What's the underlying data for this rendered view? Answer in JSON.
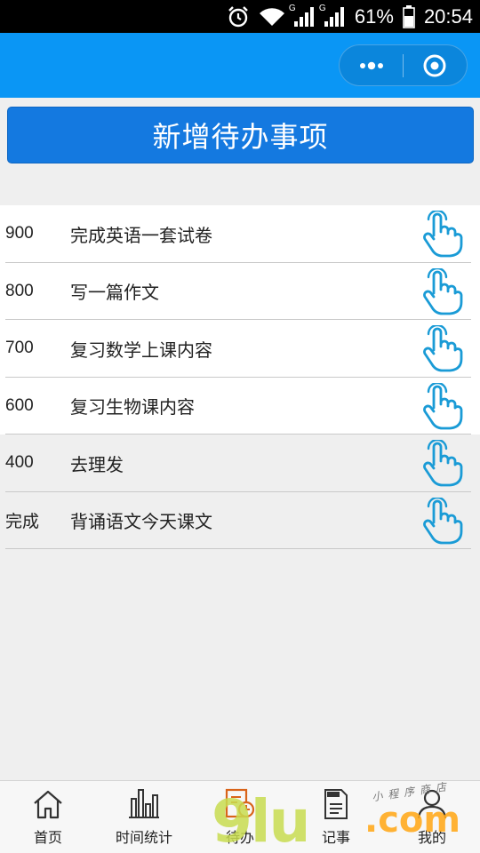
{
  "status_bar": {
    "battery": "61%",
    "time": "20:54",
    "network_label": "G",
    "icons": [
      "alarm-icon",
      "wifi-icon",
      "signal-icon",
      "signal-icon",
      "battery-icon"
    ]
  },
  "header": {
    "capsule": {
      "more_icon": "more-dots-icon",
      "close_icon": "target-circle-icon"
    }
  },
  "add_button": {
    "label": "新增待办事项"
  },
  "todos": [
    {
      "value": "900",
      "text": "完成英语一套试卷"
    },
    {
      "value": "800",
      "text": "写一篇作文"
    },
    {
      "value": "700",
      "text": "复习数学上课内容"
    },
    {
      "value": "600",
      "text": "复习生物课内容"
    },
    {
      "value": "400",
      "text": "去理发"
    },
    {
      "value": "完成",
      "text": "背诵语文今天课文"
    }
  ],
  "tabs": [
    {
      "label": "首页",
      "icon": "home-icon"
    },
    {
      "label": "时间统计",
      "icon": "bar-chart-icon"
    },
    {
      "label": "待办",
      "icon": "todo-clock-icon"
    },
    {
      "label": "记事",
      "icon": "notes-icon"
    },
    {
      "label": "我的",
      "icon": "user-icon"
    }
  ],
  "watermark": {
    "main": "9lu",
    "suffix": ".com",
    "small": "小程序商店"
  },
  "colors": {
    "header": "#0a96f5",
    "button": "#1479e0",
    "hand_icon": "#1a9bd6"
  }
}
